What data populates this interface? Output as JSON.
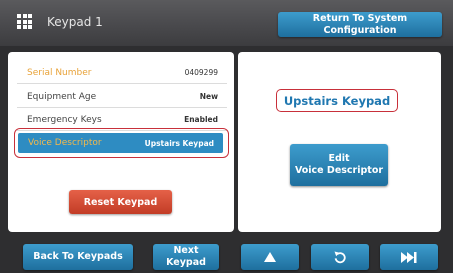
{
  "header": {
    "title": "Keypad 1",
    "return_button": "Return To System Configuration"
  },
  "details": {
    "rows": [
      {
        "label": "Serial Number",
        "value": "0409299"
      },
      {
        "label": "Equipment Age",
        "value": "New"
      },
      {
        "label": "Emergency Keys",
        "value": "Enabled"
      },
      {
        "label": "Voice Descriptor",
        "value": "Upstairs Keypad"
      }
    ],
    "reset_button": "Reset Keypad"
  },
  "descriptor_panel": {
    "current_descriptor": "Upstairs Keypad",
    "edit_button_line1": "Edit",
    "edit_button_line2": "Voice Descriptor"
  },
  "footer": {
    "back_button": "Back To Keypads",
    "next_button": "Next Keypad",
    "icons": [
      "up-arrow-icon",
      "undo-icon",
      "fast-forward-icon"
    ]
  },
  "colors": {
    "accent_blue": "#2e8cc2",
    "reset_red": "#d24a33",
    "highlight_outline": "#c8303a",
    "label_orange": "#e8a33a",
    "background": "#2e2e30"
  }
}
